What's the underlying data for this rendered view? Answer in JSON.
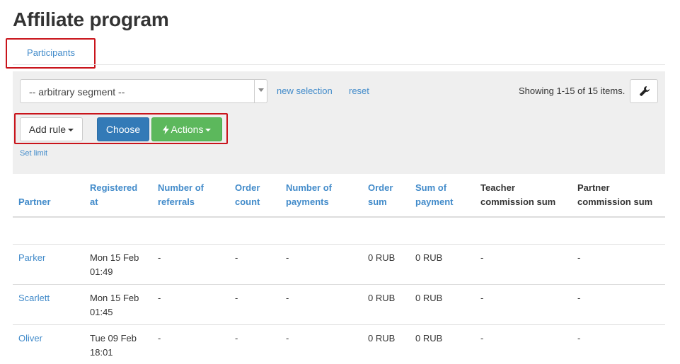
{
  "page": {
    "title": "Affiliate program"
  },
  "tabs": [
    {
      "label": "Participants"
    }
  ],
  "filter": {
    "segment_value": "-- arbitrary segment --",
    "new_selection_label": "new selection",
    "reset_label": "reset",
    "summary": "Showing 1-15 of 15 items.",
    "add_rule_label": "Add rule",
    "choose_label": "Choose",
    "actions_label": "Actions",
    "set_limit_label": "Set limit"
  },
  "colors": {
    "link": "#428bca",
    "primary": "#337ab7",
    "success": "#5cb85c",
    "highlight": "#c9141b",
    "panel": "#efefef"
  },
  "table": {
    "columns": [
      {
        "line1": "Partner",
        "line2": "",
        "sortable": true
      },
      {
        "line1": "Registered",
        "line2": "at",
        "sortable": true
      },
      {
        "line1": "Number of",
        "line2": "referrals",
        "sortable": true
      },
      {
        "line1": "Order",
        "line2": "count",
        "sortable": true
      },
      {
        "line1": "Number of",
        "line2": "payments",
        "sortable": true
      },
      {
        "line1": "Order",
        "line2": "sum",
        "sortable": true
      },
      {
        "line1": "Sum of",
        "line2": "payment",
        "sortable": true
      },
      {
        "line1": "Teacher",
        "line2": "commission sum",
        "sortable": false
      },
      {
        "line1": "Partner",
        "line2": "commission sum",
        "sortable": false
      }
    ],
    "rows": [
      {
        "partner": "Parker",
        "registered_date": "Mon 15 Feb",
        "registered_time": "01:49",
        "referrals": "-",
        "order_count": "-",
        "payments": "-",
        "order_sum": "0 RUB",
        "sum_payment": "0 RUB",
        "teacher_commission": "-",
        "partner_commission": "-"
      },
      {
        "partner": "Scarlett",
        "registered_date": "Mon 15 Feb",
        "registered_time": "01:45",
        "referrals": "-",
        "order_count": "-",
        "payments": "-",
        "order_sum": "0 RUB",
        "sum_payment": "0 RUB",
        "teacher_commission": "-",
        "partner_commission": "-"
      },
      {
        "partner": "Oliver",
        "registered_date": "Tue 09 Feb",
        "registered_time": "18:01",
        "referrals": "-",
        "order_count": "-",
        "payments": "-",
        "order_sum": "0 RUB",
        "sum_payment": "0 RUB",
        "teacher_commission": "-",
        "partner_commission": "-"
      }
    ]
  }
}
